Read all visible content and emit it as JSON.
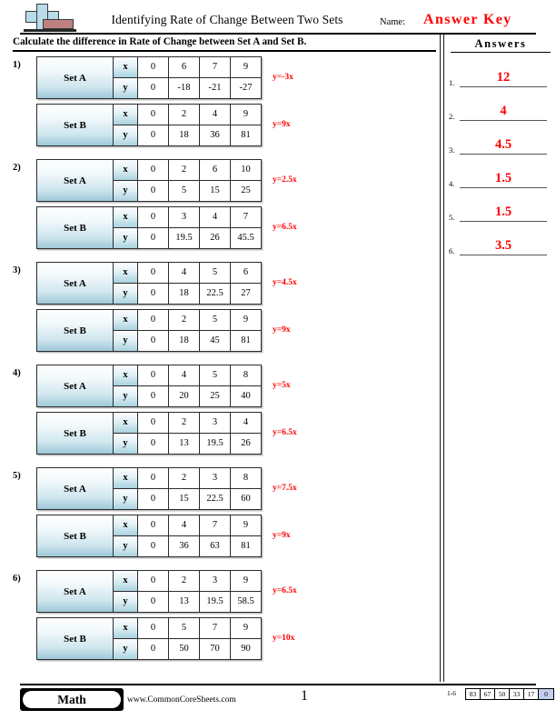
{
  "header": {
    "title": "Identifying Rate of Change Between Two Sets",
    "name_label": "Name:",
    "answer_key": "Answer Key",
    "logo_icon": "plus-book-logo"
  },
  "instruction": "Calculate the difference in Rate of Change between Set A and Set B.",
  "answers_panel": {
    "title": "Answers",
    "items": [
      {
        "num": "1.",
        "value": "12"
      },
      {
        "num": "2.",
        "value": "4"
      },
      {
        "num": "3.",
        "value": "4.5"
      },
      {
        "num": "4.",
        "value": "1.5"
      },
      {
        "num": "5.",
        "value": "1.5"
      },
      {
        "num": "6.",
        "value": "3.5"
      }
    ]
  },
  "problems": [
    {
      "num": "1)",
      "sets": [
        {
          "label": "Set A",
          "x_header": "x",
          "y_header": "y",
          "x": [
            "0",
            "6",
            "7",
            "9"
          ],
          "y": [
            "0",
            "-18",
            "-21",
            "-27"
          ],
          "equation": "y=-3x"
        },
        {
          "label": "Set B",
          "x_header": "x",
          "y_header": "y",
          "x": [
            "0",
            "2",
            "4",
            "9"
          ],
          "y": [
            "0",
            "18",
            "36",
            "81"
          ],
          "equation": "y=9x"
        }
      ]
    },
    {
      "num": "2)",
      "sets": [
        {
          "label": "Set A",
          "x_header": "x",
          "y_header": "y",
          "x": [
            "0",
            "2",
            "6",
            "10"
          ],
          "y": [
            "0",
            "5",
            "15",
            "25"
          ],
          "equation": "y=2.5x"
        },
        {
          "label": "Set B",
          "x_header": "x",
          "y_header": "y",
          "x": [
            "0",
            "3",
            "4",
            "7"
          ],
          "y": [
            "0",
            "19.5",
            "26",
            "45.5"
          ],
          "equation": "y=6.5x"
        }
      ]
    },
    {
      "num": "3)",
      "sets": [
        {
          "label": "Set A",
          "x_header": "x",
          "y_header": "y",
          "x": [
            "0",
            "4",
            "5",
            "6"
          ],
          "y": [
            "0",
            "18",
            "22.5",
            "27"
          ],
          "equation": "y=4.5x"
        },
        {
          "label": "Set B",
          "x_header": "x",
          "y_header": "y",
          "x": [
            "0",
            "2",
            "5",
            "9"
          ],
          "y": [
            "0",
            "18",
            "45",
            "81"
          ],
          "equation": "y=9x"
        }
      ]
    },
    {
      "num": "4)",
      "sets": [
        {
          "label": "Set A",
          "x_header": "x",
          "y_header": "y",
          "x": [
            "0",
            "4",
            "5",
            "8"
          ],
          "y": [
            "0",
            "20",
            "25",
            "40"
          ],
          "equation": "y=5x"
        },
        {
          "label": "Set B",
          "x_header": "x",
          "y_header": "y",
          "x": [
            "0",
            "2",
            "3",
            "4"
          ],
          "y": [
            "0",
            "13",
            "19.5",
            "26"
          ],
          "equation": "y=6.5x"
        }
      ]
    },
    {
      "num": "5)",
      "sets": [
        {
          "label": "Set A",
          "x_header": "x",
          "y_header": "y",
          "x": [
            "0",
            "2",
            "3",
            "8"
          ],
          "y": [
            "0",
            "15",
            "22.5",
            "60"
          ],
          "equation": "y=7.5x"
        },
        {
          "label": "Set B",
          "x_header": "x",
          "y_header": "y",
          "x": [
            "0",
            "4",
            "7",
            "9"
          ],
          "y": [
            "0",
            "36",
            "63",
            "81"
          ],
          "equation": "y=9x"
        }
      ]
    },
    {
      "num": "6)",
      "sets": [
        {
          "label": "Set A",
          "x_header": "x",
          "y_header": "y",
          "x": [
            "0",
            "2",
            "3",
            "9"
          ],
          "y": [
            "0",
            "13",
            "19.5",
            "58.5"
          ],
          "equation": "y=6.5x"
        },
        {
          "label": "Set B",
          "x_header": "x",
          "y_header": "y",
          "x": [
            "0",
            "5",
            "7",
            "9"
          ],
          "y": [
            "0",
            "50",
            "70",
            "90"
          ],
          "equation": "y=10x"
        }
      ]
    }
  ],
  "footer": {
    "subject_badge": "Math",
    "site_url": "www.CommonCoreSheets.com",
    "page_number": "1",
    "score_range": "1-6",
    "score_scale": [
      "83",
      "67",
      "50",
      "33",
      "17",
      "0"
    ],
    "score_highlight_index": 5
  },
  "colors": {
    "answer_red": "#ff0000",
    "set_blue": "#9ec8d8",
    "highlight": "#c3cdf0"
  }
}
